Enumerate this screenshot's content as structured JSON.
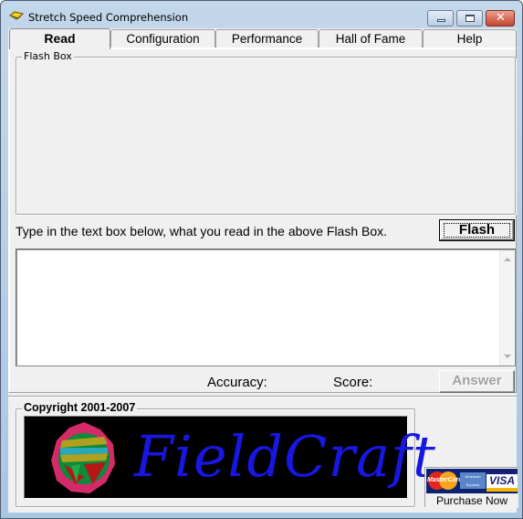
{
  "window": {
    "title": "Stretch Speed Comprehension",
    "controls": {
      "minimize": "minimize",
      "maximize": "maximize",
      "close": "✕"
    }
  },
  "tabs": [
    {
      "label": "Read",
      "active": true
    },
    {
      "label": "Configuration",
      "active": false
    },
    {
      "label": "Performance",
      "active": false
    },
    {
      "label": "Hall of Fame",
      "active": false
    },
    {
      "label": "Help",
      "active": false
    }
  ],
  "read": {
    "flash_box_label": "Flash Box",
    "flash_box_content": "",
    "instruction": "Type in the text box below, what you read in the above Flash Box.",
    "flash_button": "Flash",
    "answer_input": {
      "value": "",
      "placeholder": ""
    },
    "accuracy_label": "Accuracy:",
    "accuracy_value": "",
    "score_label": "Score:",
    "score_value": "",
    "answer_button": "Answer",
    "answer_button_enabled": false
  },
  "footer": {
    "copyright_label": "Copyright  2001-2007",
    "logo_text": "FieldCraft",
    "purchase_label": "Purchase Now",
    "card_brands": [
      "MasterCard",
      "American Express",
      "VISA"
    ]
  },
  "icons": {
    "app": "open-book-icon",
    "scroll_up": "scroll-up-arrow-icon",
    "scroll_down": "scroll-down-arrow-icon"
  }
}
